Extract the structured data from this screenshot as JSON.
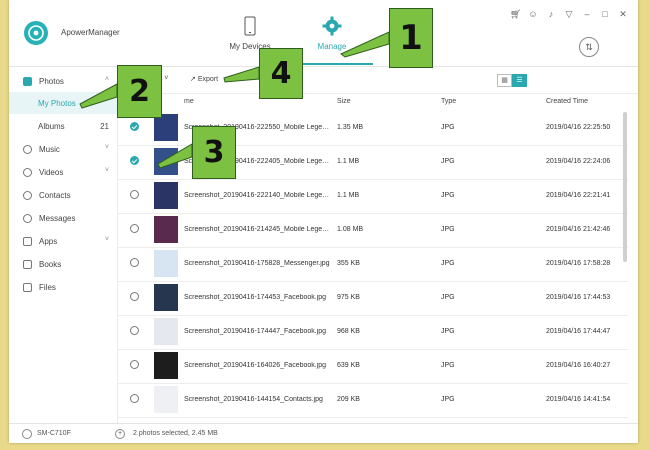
{
  "app": {
    "title": "ApowerManager"
  },
  "nav": {
    "tabs": [
      {
        "label": "My Devices"
      },
      {
        "label": "Manage"
      }
    ]
  },
  "sidebar": {
    "items": [
      {
        "label": "Photos",
        "icon": "photo-icon"
      },
      {
        "label": "My Photos"
      },
      {
        "label": "Albums",
        "count": "21"
      },
      {
        "label": "Music",
        "icon": "music-icon"
      },
      {
        "label": "Videos",
        "icon": "video-icon"
      },
      {
        "label": "Contacts",
        "icon": "contacts-icon"
      },
      {
        "label": "Messages",
        "icon": "messages-icon"
      },
      {
        "label": "Apps",
        "icon": "apps-icon"
      },
      {
        "label": "Books",
        "icon": "book-icon"
      },
      {
        "label": "Files",
        "icon": "file-icon"
      }
    ]
  },
  "toolbar": {
    "import_label": "rt",
    "export_label": "Export"
  },
  "table": {
    "headers": {
      "name": "me",
      "size": "Size",
      "type": "Type",
      "created": "Created Time"
    },
    "rows": [
      {
        "name": "Screenshot_20190416-222550_Mobile Legen...",
        "size": "1.35 MB",
        "type": "JPG",
        "created": "2019/04/16 22:25:50",
        "checked": true,
        "thumb": "#2c3f7a"
      },
      {
        "name": "Screenshot_20190416-222405_Mobile Legen...",
        "size": "1.1 MB",
        "type": "JPG",
        "created": "2019/04/16 22:24:06",
        "checked": true,
        "thumb": "#34508a"
      },
      {
        "name": "Screenshot_20190416-222140_Mobile Legen...",
        "size": "1.1 MB",
        "type": "JPG",
        "created": "2019/04/16 22:21:41",
        "checked": false,
        "thumb": "#2a3566"
      },
      {
        "name": "Screenshot_20190416-214245_Mobile Legen...",
        "size": "1.08 MB",
        "type": "JPG",
        "created": "2019/04/16 21:42:46",
        "checked": false,
        "thumb": "#5a2a4e"
      },
      {
        "name": "Screenshot_20190416-175828_Messenger.jpg",
        "size": "355 KB",
        "type": "JPG",
        "created": "2019/04/16 17:58:28",
        "checked": false,
        "thumb": "#d7e4f2"
      },
      {
        "name": "Screenshot_20190416-174453_Facebook.jpg",
        "size": "975 KB",
        "type": "JPG",
        "created": "2019/04/16 17:44:53",
        "checked": false,
        "thumb": "#26364e"
      },
      {
        "name": "Screenshot_20190416-174447_Facebook.jpg",
        "size": "968 KB",
        "type": "JPG",
        "created": "2019/04/16 17:44:47",
        "checked": false,
        "thumb": "#e5e8ee"
      },
      {
        "name": "Screenshot_20190416-164026_Facebook.jpg",
        "size": "639 KB",
        "type": "JPG",
        "created": "2019/04/16 16:40:27",
        "checked": false,
        "thumb": "#1d1d1d"
      },
      {
        "name": "Screenshot_20190416-144154_Contacts.jpg",
        "size": "209 KB",
        "type": "JPG",
        "created": "2019/04/16 14:41:54",
        "checked": false,
        "thumb": "#eef0f4"
      }
    ]
  },
  "status": {
    "device": "SM-C710F",
    "selection": "2 photos selected, 2.45 MB"
  },
  "callouts": [
    {
      "label": "1"
    },
    {
      "label": "2"
    },
    {
      "label": "3"
    },
    {
      "label": "4"
    }
  ],
  "colors": {
    "accent": "#2aa8b0",
    "callout": "#7cc142",
    "desktop": "#e9d98a"
  }
}
